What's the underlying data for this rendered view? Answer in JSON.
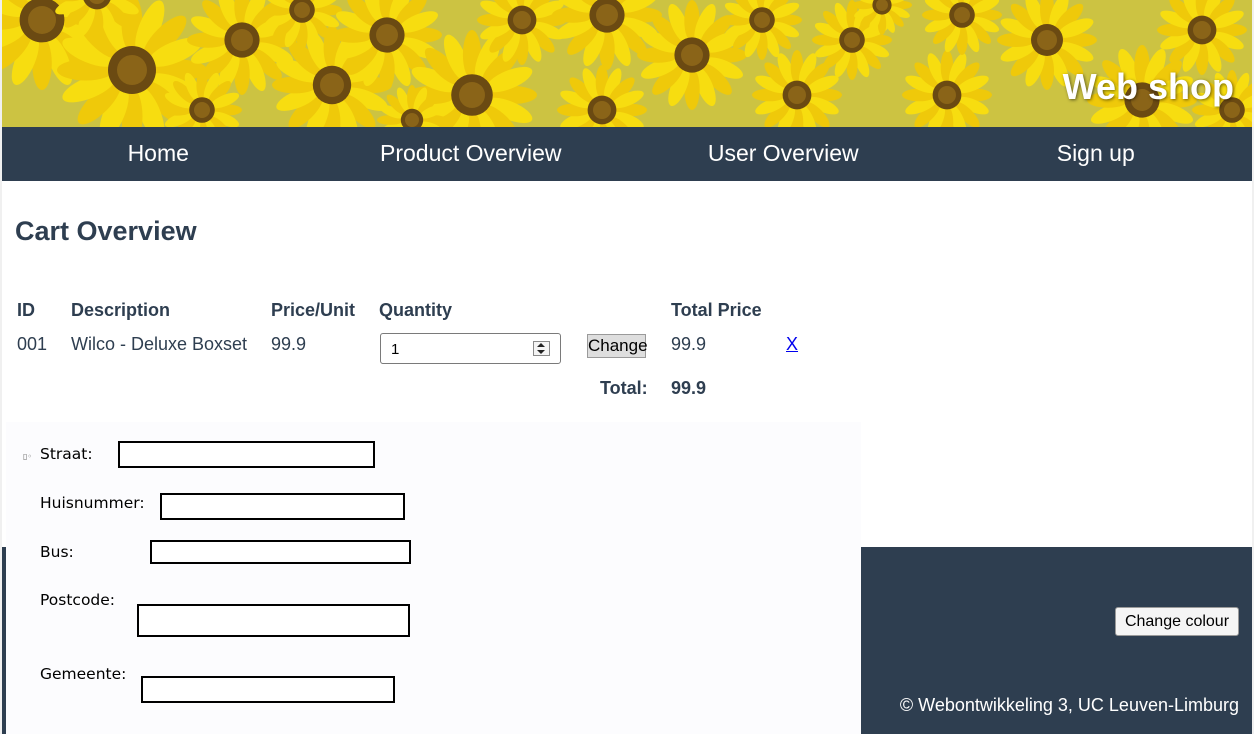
{
  "header": {
    "site_title": "Web shop"
  },
  "nav": {
    "items": [
      {
        "label": "Home"
      },
      {
        "label": "Product Overview"
      },
      {
        "label": "User Overview"
      },
      {
        "label": "Sign up"
      }
    ]
  },
  "main": {
    "title": "Cart Overview",
    "table": {
      "headers": {
        "id": "ID",
        "description": "Description",
        "price_unit": "Price/Unit",
        "quantity": "Quantity",
        "total_price": "Total Price"
      },
      "rows": [
        {
          "id": "001",
          "description": "Wilco - Deluxe Boxset",
          "price_unit": "99.9",
          "quantity": "1",
          "change_label": "Change",
          "total_price": "99.9",
          "remove_label": "X"
        }
      ],
      "total_label": "Total:",
      "total_value": "99.9"
    }
  },
  "address_form": {
    "straat_label": "Straat:",
    "huisnummer_label": "Huisnummer:",
    "bus_label": "Bus:",
    "postcode_label": "Postcode:",
    "gemeente_label": "Gemeente:",
    "straat_value": "",
    "huisnummer_value": "",
    "bus_value": "",
    "postcode_value": "",
    "gemeente_value": ""
  },
  "footer": {
    "change_colour_label": "Change colour",
    "copyright": "© Webontwikkeling 3, UC Leuven-Limburg"
  },
  "colors": {
    "nav_bg": "#2e3e50",
    "heading_text": "#2e3e50",
    "link": "#0000ee",
    "banner_yellow": "#f2d21c"
  },
  "icons": {
    "banner": "sunflower-field-image",
    "spinner": "up-down-spinner-icon"
  }
}
